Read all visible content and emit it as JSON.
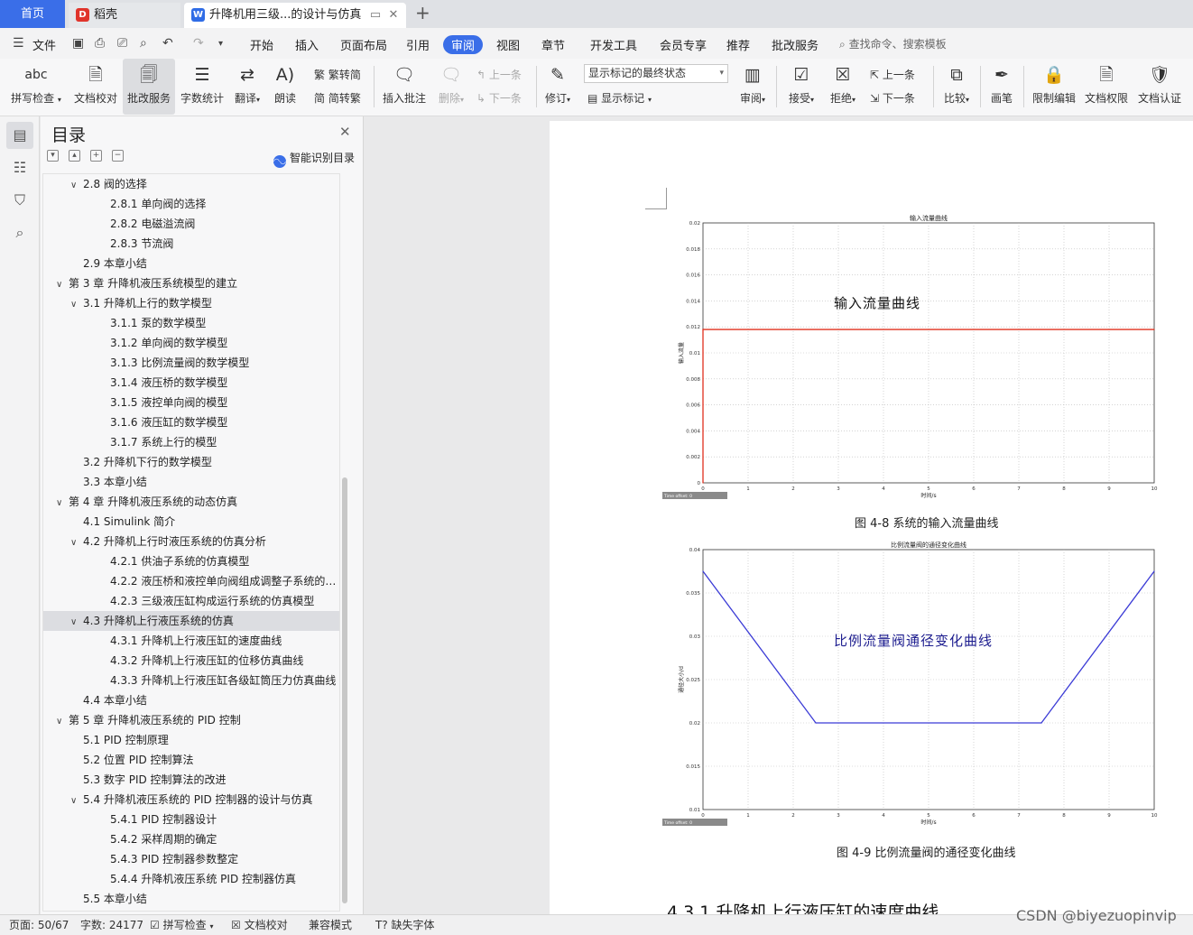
{
  "tabs": {
    "home": "首页",
    "daoke": "稻壳",
    "doc": "升降机用三级...的设计与仿真"
  },
  "menu": {
    "file": "文件",
    "items": [
      "开始",
      "插入",
      "页面布局",
      "引用",
      "审阅",
      "视图",
      "章节",
      "开发工具",
      "会员专享",
      "推荐",
      "批改服务"
    ],
    "active": "审阅",
    "search": "查找命令、搜索模板"
  },
  "ribbon": {
    "spell_check": "拼写检查",
    "doc_check": "文档校对",
    "correction": "批改服务",
    "word_count": "字数统计",
    "translate": "翻译",
    "read_aloud": "朗读",
    "to_traditional": "繁转简",
    "to_simplified": "简转繁",
    "insert_comment": "插入批注",
    "delete": "删除",
    "prev": "上一条",
    "next": "下一条",
    "revise": "修订",
    "markup_state": "显示标记的最终状态",
    "show_markup": "显示标记",
    "review": "审阅",
    "accept": "接受",
    "reject": "拒绝",
    "prev2": "上一条",
    "next2": "下一条",
    "compare": "比较",
    "pen": "画笔",
    "restrict": "限制编辑",
    "permission": "文档权限",
    "certify": "文档认证"
  },
  "toc": {
    "title": "目录",
    "smart": "智能识别目录",
    "items": [
      {
        "label": "2.8  阀的选择",
        "level": 2,
        "expand": true
      },
      {
        "label": "2.8.1  单向阀的选择",
        "level": 3
      },
      {
        "label": "2.8.2  电磁溢流阀",
        "level": 3
      },
      {
        "label": "2.8.3  节流阀",
        "level": 3
      },
      {
        "label": "2.9  本章小结",
        "level": 2
      },
      {
        "label": "第 3 章  升降机液压系统模型的建立",
        "level": 1,
        "expand": true
      },
      {
        "label": "3.1 升降机上行的数学模型",
        "level": 2,
        "expand": true
      },
      {
        "label": "3.1.1  泵的数学模型",
        "level": 3
      },
      {
        "label": "3.1.2  单向阀的数学模型",
        "level": 3
      },
      {
        "label": "3.1.3  比例流量阀的数学模型",
        "level": 3
      },
      {
        "label": "3.1.4  液压桥的数学模型",
        "level": 3
      },
      {
        "label": "3.1.5  液控单向阀的模型",
        "level": 3
      },
      {
        "label": "3.1.6  液压缸的数学模型",
        "level": 3
      },
      {
        "label": "3.1.7  系统上行的模型",
        "level": 3
      },
      {
        "label": "3.2  升降机下行的数学模型",
        "level": 2
      },
      {
        "label": "3.3  本章小结",
        "level": 2
      },
      {
        "label": "第 4 章  升降机液压系统的动态仿真",
        "level": 1,
        "expand": true
      },
      {
        "label": "4.1 Simulink 简介",
        "level": 2
      },
      {
        "label": "4.2 升降机上行时液压系统的仿真分析",
        "level": 2,
        "expand": true
      },
      {
        "label": "4.2.1  供油子系统的仿真模型",
        "level": 3
      },
      {
        "label": "4.2.2  液压桥和液控单向阀组成调整子系统的仿真模型",
        "level": 3
      },
      {
        "label": "4.2.3  三级液压缸构成运行系统的仿真模型",
        "level": 3
      },
      {
        "label": "4.3  升降机上行液压系统的仿真",
        "level": 2,
        "expand": true,
        "selected": true
      },
      {
        "label": "4.3.1  升降机上行液压缸的速度曲线",
        "level": 3
      },
      {
        "label": "4.3.2  升降机上行液压缸的位移仿真曲线",
        "level": 3
      },
      {
        "label": "4.3.3  升降机上行液压缸各级缸筒压力仿真曲线",
        "level": 3
      },
      {
        "label": "4.4  本章小结",
        "level": 2
      },
      {
        "label": "第 5 章  升降机液压系统的 PID 控制",
        "level": 1,
        "expand": true
      },
      {
        "label": "5.1 PID 控制原理",
        "level": 2
      },
      {
        "label": "5.2  位置 PID 控制算法",
        "level": 2
      },
      {
        "label": "5.3  数字 PID 控制算法的改进",
        "level": 2
      },
      {
        "label": "5.4  升降机液压系统的 PID 控制器的设计与仿真",
        "level": 2,
        "expand": true
      },
      {
        "label": "5.4.1 PID 控制器设计",
        "level": 3
      },
      {
        "label": "5.4.2  采样周期的确定",
        "level": 3
      },
      {
        "label": "5.4.3 PID 控制器参数整定",
        "level": 3
      },
      {
        "label": "5.4.4  升降机液压系统 PID 控制器仿真",
        "level": 3
      },
      {
        "label": "5.5  本章小结",
        "level": 2
      }
    ]
  },
  "doc": {
    "caption1": "图 4-8  系统的输入流量曲线",
    "caption2": "图 4-9  比例流量阀的通径变化曲线",
    "section": "4.3.1  升降机上行液压缸的速度曲线"
  },
  "chart_data": [
    {
      "type": "line",
      "title": "输入流量曲线",
      "annotation": "输入流量曲线",
      "xlabel": "时间/s",
      "ylabel": "输入流量",
      "xlim": [
        0,
        10
      ],
      "ylim": [
        0,
        0.02
      ],
      "xticks": [
        "0",
        "1",
        "2",
        "3",
        "4",
        "5",
        "6",
        "7",
        "8",
        "9",
        "10"
      ],
      "yticks": [
        "0",
        "0.002",
        "0.004",
        "0.006",
        "0.008",
        "0.01",
        "0.012",
        "0.014",
        "0.016",
        "0.018",
        "0.02"
      ],
      "grid": true,
      "color": "#e0301e",
      "x": [
        0,
        0,
        10
      ],
      "y": [
        0,
        0.0118,
        0.0118
      ],
      "footer": "Time offset: 0"
    },
    {
      "type": "line",
      "title": "比例流量阀的通径变化曲线",
      "annotation": "比例流量阀通径变化曲线",
      "xlabel": "时间/s",
      "ylabel": "通径大小/d",
      "xlim": [
        0,
        10
      ],
      "ylim": [
        0.01,
        0.04
      ],
      "xticks": [
        "0",
        "1",
        "2",
        "3",
        "4",
        "5",
        "6",
        "7",
        "8",
        "9",
        "10"
      ],
      "yticks": [
        "0.01",
        "0.015",
        "0.02",
        "0.025",
        "0.03",
        "0.035",
        "0.04"
      ],
      "grid": true,
      "color": "#3b3bd6",
      "x": [
        0,
        2.5,
        7.5,
        10
      ],
      "y": [
        0.0375,
        0.02,
        0.02,
        0.0375
      ],
      "footer": "Time offset: 0"
    }
  ],
  "status": {
    "page": "页面: 50/67",
    "words": "字数: 24177",
    "spell": "拼写检查",
    "doc_check": "文档校对",
    "compat": "兼容模式",
    "missing_font": "缺失字体"
  },
  "watermark": "CSDN @biyezuopinvip"
}
